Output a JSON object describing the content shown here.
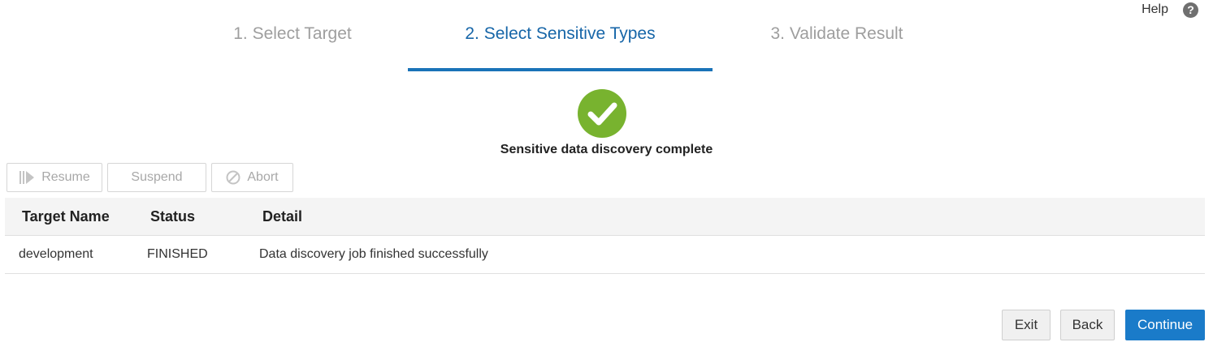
{
  "help": {
    "label": "Help",
    "icon_glyph": "?",
    "icon": "question-circle-icon"
  },
  "train": {
    "steps": [
      {
        "label": "1. Select Target",
        "state": "visited"
      },
      {
        "label": "2. Select Sensitive Types",
        "state": "current"
      },
      {
        "label": "3. Validate Result",
        "state": "unvisited"
      }
    ]
  },
  "status": {
    "icon": "check-circle-icon",
    "message": "Sensitive data discovery complete",
    "color": "#78b32f"
  },
  "toolbar": {
    "resume_label": "Resume",
    "suspend_label": "Suspend",
    "abort_label": "Abort"
  },
  "table": {
    "columns": [
      "Target Name",
      "Status",
      "Detail"
    ],
    "rows": [
      {
        "target_name": "development",
        "status": "FINISHED",
        "detail": "Data discovery job finished successfully"
      }
    ]
  },
  "footer": {
    "exit_label": "Exit",
    "back_label": "Back",
    "continue_label": "Continue"
  },
  "colors": {
    "accent": "#1a73b8",
    "primary_button": "#1a7bc9",
    "success": "#78b32f"
  }
}
